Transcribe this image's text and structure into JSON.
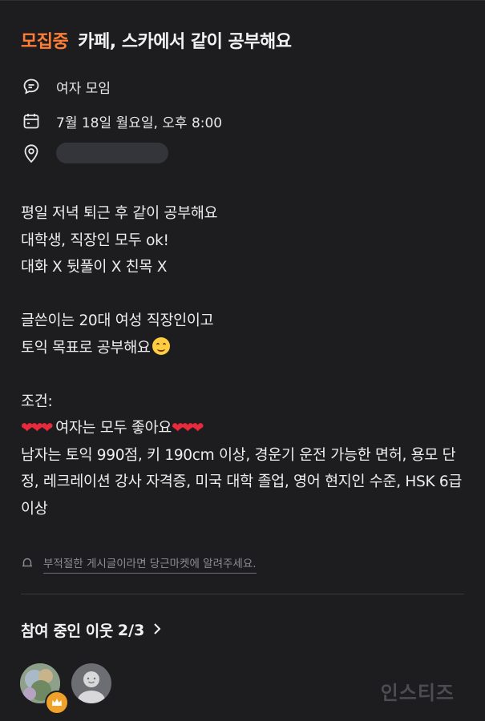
{
  "post": {
    "status": "모집중",
    "title": "카페, 스카에서 같이 공부해요"
  },
  "info": {
    "group_type": "여자 모임",
    "datetime": "7월 18일 월요일, 오후 8:00",
    "location_icon": "location-pin-icon"
  },
  "body": {
    "lines_a": [
      "평일 저녁 퇴근 후 같이 공부해요",
      "대학생, 직장인 모두 ok!",
      "대화 X 뒷풀이 X 친목 X"
    ],
    "lines_b_1": "글쓴이는 20대 여성 직장인이고",
    "lines_b_2": "토익 목표로 공부해요",
    "cond_label": "조건:",
    "hearts": "❤❤❤",
    "cond_women": "여자는 모두 좋아요",
    "cond_men": "남자는 토익 990점, 키 190cm 이상, 경운기 운전 가능한 면허, 용모 단정, 레크레이션 강사 자격증, 미국 대학 졸업, 영어 현지인 수준, HSK 6급 이상"
  },
  "report_text": "부적절한 게시글이라면 당근마켓에 알려주세요.",
  "participants": {
    "label": "참여 중인 이웃",
    "count": "2/3"
  },
  "watermark": "인스티즈",
  "colors": {
    "accent": "#ff7e36",
    "background": "#1d1d20",
    "heart": "#e82a3c",
    "crown": "#efa12a"
  }
}
